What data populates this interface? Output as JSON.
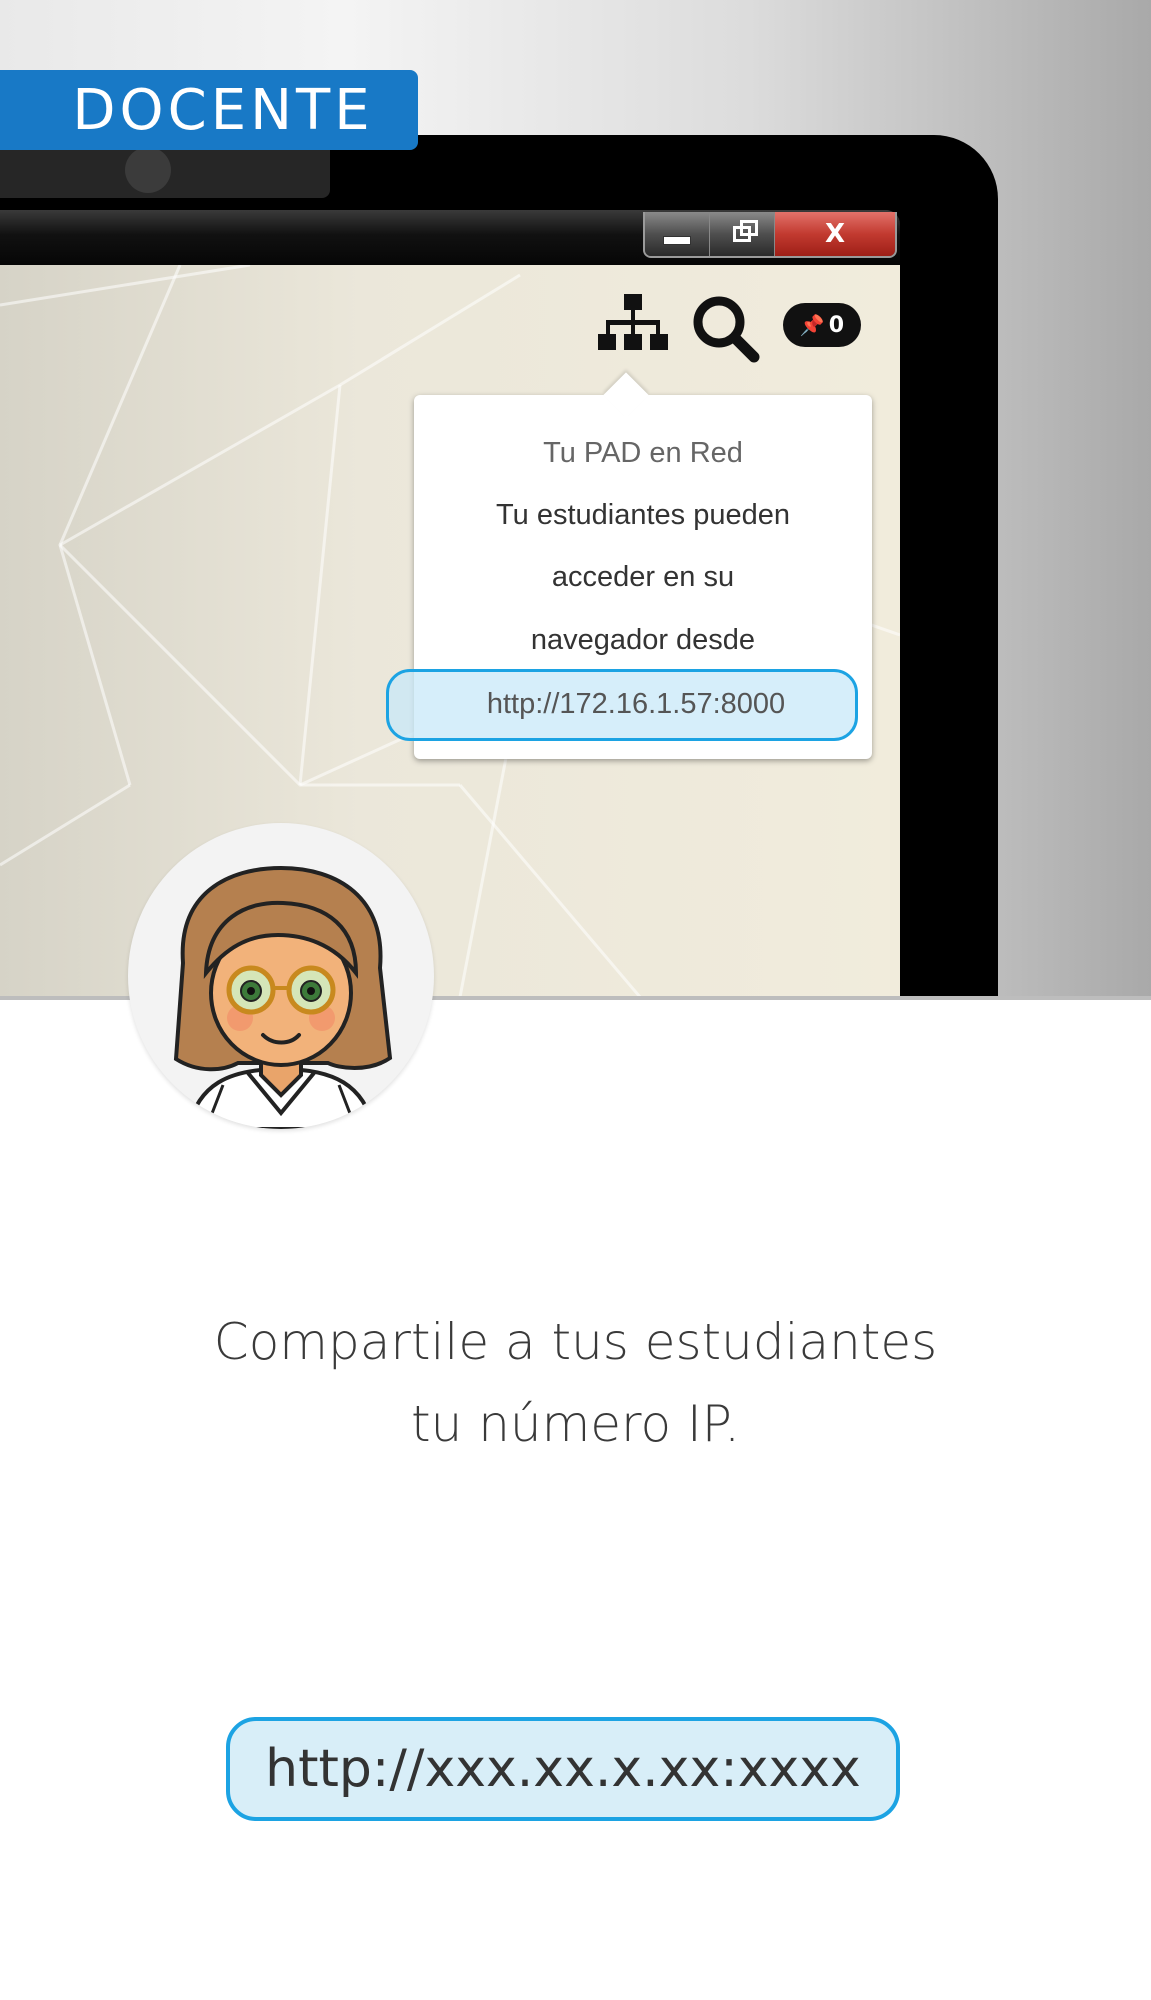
{
  "badge": {
    "label": "DOCENTE"
  },
  "window": {
    "controls": {
      "minimize_icon": "minimize-icon",
      "maximize_icon": "restore-icon",
      "close_label": "X"
    }
  },
  "toolbar": {
    "network_icon": "sitemap-icon",
    "search_icon": "search-icon",
    "pin_count": "0"
  },
  "popover": {
    "title": "Tu PAD en Red",
    "line1": "Tu estudiantes pueden",
    "line2": "acceder en su",
    "line3": "navegador desde",
    "url": "http://172.16.1.57:8000"
  },
  "caption": {
    "line1": "Compartile a tus estudiantes",
    "line2": "tu número IP."
  },
  "ip_placeholder": "http://xxx.xx.x.xx:xxxx",
  "colors": {
    "badge_blue": "#1879c6",
    "highlight_border": "#1ca3e3",
    "highlight_fill": "#d8eef8",
    "close_red": "#c23a30"
  }
}
